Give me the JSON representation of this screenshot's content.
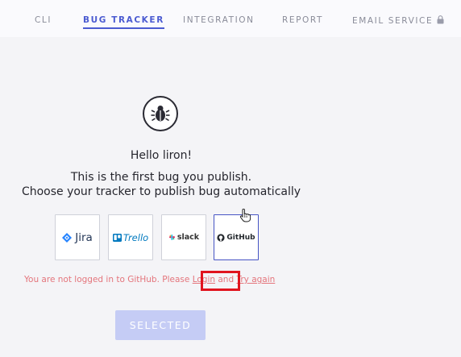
{
  "tabs": [
    {
      "label": "CLI"
    },
    {
      "label": "BUG TRACKER",
      "active": true
    },
    {
      "label": "INTEGRATION"
    },
    {
      "label": "REPORT"
    },
    {
      "label": "EMAIL SERVICE",
      "locked": true
    }
  ],
  "content": {
    "bug_icon": "bug-icon",
    "greeting": "Hello liron!",
    "line1": "This is the first bug you publish.",
    "line2": "Choose your tracker to publish bug automatically"
  },
  "trackers": [
    {
      "name": "Jira",
      "icon": "jira-icon"
    },
    {
      "name": "Trello",
      "icon": "trello-icon"
    },
    {
      "name": "slack",
      "icon": "slack-icon"
    },
    {
      "name": "GitHub",
      "icon": "github-icon",
      "selected": true
    }
  ],
  "error": {
    "prefix": "You are not logged in to GitHub. Please ",
    "login": "Login",
    "middle": " and ",
    "retry": "Try again"
  },
  "button": {
    "label": "SELECTED"
  },
  "colors": {
    "accent": "#4b5bd1",
    "error": "#e4757c",
    "button_bg": "#c5ccf5",
    "highlight": "#e0141e"
  }
}
